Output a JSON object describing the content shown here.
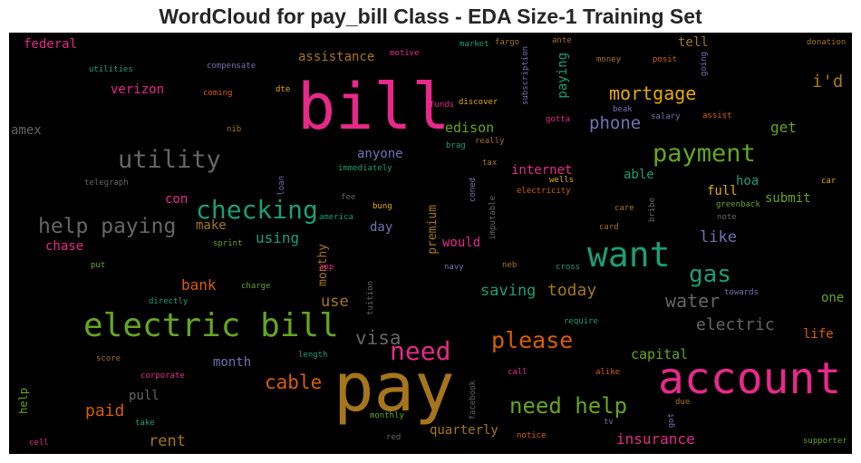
{
  "chart_data": {
    "type": "wordcloud",
    "title": "WordCloud for pay_bill Class - EDA Size-1 Training Set",
    "background": "#000000",
    "palette": [
      "#1b9e77",
      "#d95f02",
      "#7570b3",
      "#e7298a",
      "#66a61e",
      "#e6ab02",
      "#a6761d",
      "#666666"
    ],
    "words": [
      {
        "text": "pay",
        "color": "#a6761d"
      },
      {
        "text": "bill",
        "color": "#e7298a"
      },
      {
        "text": "account",
        "color": "#e7298a"
      },
      {
        "text": "want",
        "color": "#1b9e77"
      },
      {
        "text": "electric bill",
        "color": "#66a61e"
      },
      {
        "text": "checking",
        "color": "#1b9e77"
      },
      {
        "text": "payment",
        "color": "#66a61e"
      },
      {
        "text": "utility",
        "color": "#666666"
      },
      {
        "text": "help paying",
        "color": "#666666"
      },
      {
        "text": "need",
        "color": "#e7298a"
      },
      {
        "text": "gas",
        "color": "#1b9e77"
      },
      {
        "text": "please",
        "color": "#d95f02"
      },
      {
        "text": "need help",
        "color": "#66a61e"
      },
      {
        "text": "mortgage",
        "color": "#e6ab02"
      },
      {
        "text": "visa",
        "color": "#666666"
      },
      {
        "text": "water",
        "color": "#666666"
      },
      {
        "text": "cable",
        "color": "#d95f02"
      },
      {
        "text": "phone",
        "color": "#7570b3"
      },
      {
        "text": "i'd",
        "color": "#a6761d"
      },
      {
        "text": "electric",
        "color": "#666666"
      },
      {
        "text": "saving",
        "color": "#1b9e77"
      },
      {
        "text": "today",
        "color": "#a6761d"
      },
      {
        "text": "insurance",
        "color": "#e7298a"
      },
      {
        "text": "paid",
        "color": "#d95f02"
      },
      {
        "text": "rent",
        "color": "#a6761d"
      },
      {
        "text": "like",
        "color": "#7570b3"
      },
      {
        "text": "get",
        "color": "#66a61e"
      },
      {
        "text": "capital",
        "color": "#66a61e"
      },
      {
        "text": "use",
        "color": "#a6761d"
      },
      {
        "text": "bank",
        "color": "#d95f02"
      },
      {
        "text": "using",
        "color": "#1b9e77"
      },
      {
        "text": "edison",
        "color": "#66a61e"
      },
      {
        "text": "anyone",
        "color": "#7570b3"
      },
      {
        "text": "assistance",
        "color": "#a6761d"
      },
      {
        "text": "verizon",
        "color": "#e7298a"
      },
      {
        "text": "federal",
        "color": "#e7298a"
      },
      {
        "text": "amex",
        "color": "#666666"
      },
      {
        "text": "internet",
        "color": "#e7298a"
      },
      {
        "text": "full",
        "color": "#e6ab02"
      },
      {
        "text": "hoa",
        "color": "#1b9e77"
      },
      {
        "text": "submit",
        "color": "#66a61e"
      },
      {
        "text": "able",
        "color": "#1b9e77"
      },
      {
        "text": "tell",
        "color": "#a6761d"
      },
      {
        "text": "chase",
        "color": "#e7298a"
      },
      {
        "text": "con",
        "color": "#e7298a"
      },
      {
        "text": "make",
        "color": "#a6761d"
      },
      {
        "text": "day",
        "color": "#7570b3"
      },
      {
        "text": "would",
        "color": "#e7298a"
      },
      {
        "text": "pull",
        "color": "#666666"
      },
      {
        "text": "month",
        "color": "#7570b3"
      },
      {
        "text": "quarterly",
        "color": "#a6761d"
      },
      {
        "text": "life",
        "color": "#d95f02"
      },
      {
        "text": "one",
        "color": "#66a61e"
      },
      {
        "text": "paying",
        "color": "#1b9e77"
      },
      {
        "text": "premium",
        "color": "#a6761d"
      },
      {
        "text": "monthy",
        "color": "#a6761d"
      },
      {
        "text": "help",
        "color": "#66a61e"
      },
      {
        "text": "utilities",
        "color": "#1b9e77"
      },
      {
        "text": "compensate",
        "color": "#7570b3"
      },
      {
        "text": "motive",
        "color": "#e7298a"
      },
      {
        "text": "market",
        "color": "#1b9e77"
      },
      {
        "text": "fargo",
        "color": "#a6761d"
      },
      {
        "text": "ante",
        "color": "#a6761d"
      },
      {
        "text": "subscription",
        "color": "#7570b3"
      },
      {
        "text": "money",
        "color": "#a6761d"
      },
      {
        "text": "posit",
        "color": "#d95f02"
      },
      {
        "text": "going",
        "color": "#7570b3"
      },
      {
        "text": "donation",
        "color": "#a6761d"
      },
      {
        "text": "coming",
        "color": "#d95f02"
      },
      {
        "text": "dte",
        "color": "#e6ab02"
      },
      {
        "text": "funds",
        "color": "#e7298a"
      },
      {
        "text": "discover",
        "color": "#e6ab02"
      },
      {
        "text": "beak",
        "color": "#7570b3"
      },
      {
        "text": "salary",
        "color": "#7570b3"
      },
      {
        "text": "assist",
        "color": "#d95f02"
      },
      {
        "text": "gotta",
        "color": "#e7298a"
      },
      {
        "text": "nib",
        "color": "#a6761d"
      },
      {
        "text": "brag",
        "color": "#1b9e77"
      },
      {
        "text": "really",
        "color": "#a6761d"
      },
      {
        "text": "immediately",
        "color": "#1b9e77"
      },
      {
        "text": "loan",
        "color": "#7570b3"
      },
      {
        "text": "tax",
        "color": "#a6761d"
      },
      {
        "text": "telegraph",
        "color": "#666666"
      },
      {
        "text": "fee",
        "color": "#666666"
      },
      {
        "text": "coned",
        "color": "#7570b3"
      },
      {
        "text": "wells",
        "color": "#e6ab02"
      },
      {
        "text": "electricity",
        "color": "#d95f02"
      },
      {
        "text": "car",
        "color": "#e6ab02"
      },
      {
        "text": "america",
        "color": "#1b9e77"
      },
      {
        "text": "bung",
        "color": "#e6ab02"
      },
      {
        "text": "imputable",
        "color": "#666666"
      },
      {
        "text": "care",
        "color": "#a6761d"
      },
      {
        "text": "bribe",
        "color": "#666666"
      },
      {
        "text": "greenback",
        "color": "#66a61e"
      },
      {
        "text": "note",
        "color": "#666666"
      },
      {
        "text": "card",
        "color": "#a6761d"
      },
      {
        "text": "sprint",
        "color": "#66a61e"
      },
      {
        "text": "put",
        "color": "#66a61e"
      },
      {
        "text": "app",
        "color": "#e7298a"
      },
      {
        "text": "navy",
        "color": "#7570b3"
      },
      {
        "text": "neb",
        "color": "#a6761d"
      },
      {
        "text": "cross",
        "color": "#1b9e77"
      },
      {
        "text": "directly",
        "color": "#1b9e77"
      },
      {
        "text": "charge",
        "color": "#66a61e"
      },
      {
        "text": "tuition",
        "color": "#666666"
      },
      {
        "text": "towards",
        "color": "#7570b3"
      },
      {
        "text": "require",
        "color": "#1b9e77"
      },
      {
        "text": "length",
        "color": "#1b9e77"
      },
      {
        "text": "score",
        "color": "#a6761d"
      },
      {
        "text": "corporate",
        "color": "#e7298a"
      },
      {
        "text": "call",
        "color": "#e7298a"
      },
      {
        "text": "alike",
        "color": "#d95f02"
      },
      {
        "text": "facebook",
        "color": "#666666"
      },
      {
        "text": "due",
        "color": "#a6761d"
      },
      {
        "text": "take",
        "color": "#1b9e77"
      },
      {
        "text": "monthly",
        "color": "#66a61e"
      },
      {
        "text": "tv",
        "color": "#7570b3"
      },
      {
        "text": "got",
        "color": "#7570b3"
      },
      {
        "text": "cell",
        "color": "#e7298a"
      },
      {
        "text": "red",
        "color": "#666666"
      },
      {
        "text": "notice",
        "color": "#d95f02"
      },
      {
        "text": "supporter",
        "color": "#66a61e"
      }
    ]
  }
}
